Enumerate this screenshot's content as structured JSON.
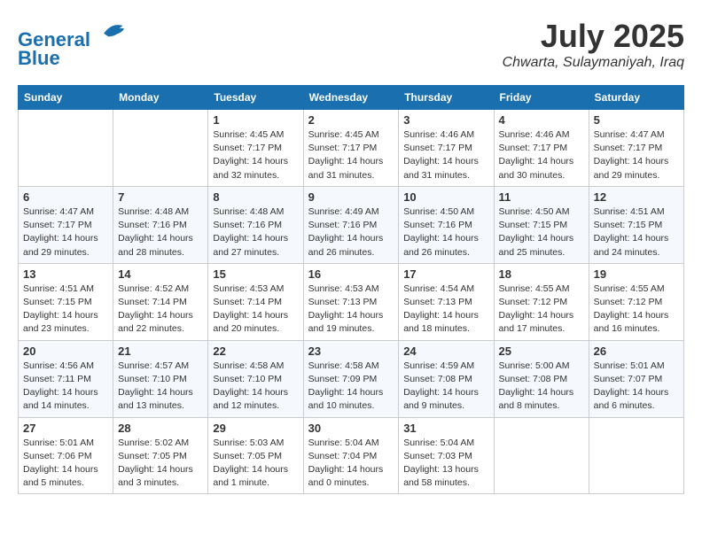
{
  "header": {
    "logo_line1": "General",
    "logo_line2": "Blue",
    "month_year": "July 2025",
    "location": "Chwarta, Sulaymaniyah, Iraq"
  },
  "weekdays": [
    "Sunday",
    "Monday",
    "Tuesday",
    "Wednesday",
    "Thursday",
    "Friday",
    "Saturday"
  ],
  "weeks": [
    [
      {
        "day": "",
        "info": ""
      },
      {
        "day": "",
        "info": ""
      },
      {
        "day": "1",
        "info": "Sunrise: 4:45 AM\nSunset: 7:17 PM\nDaylight: 14 hours\nand 32 minutes."
      },
      {
        "day": "2",
        "info": "Sunrise: 4:45 AM\nSunset: 7:17 PM\nDaylight: 14 hours\nand 31 minutes."
      },
      {
        "day": "3",
        "info": "Sunrise: 4:46 AM\nSunset: 7:17 PM\nDaylight: 14 hours\nand 31 minutes."
      },
      {
        "day": "4",
        "info": "Sunrise: 4:46 AM\nSunset: 7:17 PM\nDaylight: 14 hours\nand 30 minutes."
      },
      {
        "day": "5",
        "info": "Sunrise: 4:47 AM\nSunset: 7:17 PM\nDaylight: 14 hours\nand 29 minutes."
      }
    ],
    [
      {
        "day": "6",
        "info": "Sunrise: 4:47 AM\nSunset: 7:17 PM\nDaylight: 14 hours\nand 29 minutes."
      },
      {
        "day": "7",
        "info": "Sunrise: 4:48 AM\nSunset: 7:16 PM\nDaylight: 14 hours\nand 28 minutes."
      },
      {
        "day": "8",
        "info": "Sunrise: 4:48 AM\nSunset: 7:16 PM\nDaylight: 14 hours\nand 27 minutes."
      },
      {
        "day": "9",
        "info": "Sunrise: 4:49 AM\nSunset: 7:16 PM\nDaylight: 14 hours\nand 26 minutes."
      },
      {
        "day": "10",
        "info": "Sunrise: 4:50 AM\nSunset: 7:16 PM\nDaylight: 14 hours\nand 26 minutes."
      },
      {
        "day": "11",
        "info": "Sunrise: 4:50 AM\nSunset: 7:15 PM\nDaylight: 14 hours\nand 25 minutes."
      },
      {
        "day": "12",
        "info": "Sunrise: 4:51 AM\nSunset: 7:15 PM\nDaylight: 14 hours\nand 24 minutes."
      }
    ],
    [
      {
        "day": "13",
        "info": "Sunrise: 4:51 AM\nSunset: 7:15 PM\nDaylight: 14 hours\nand 23 minutes."
      },
      {
        "day": "14",
        "info": "Sunrise: 4:52 AM\nSunset: 7:14 PM\nDaylight: 14 hours\nand 22 minutes."
      },
      {
        "day": "15",
        "info": "Sunrise: 4:53 AM\nSunset: 7:14 PM\nDaylight: 14 hours\nand 20 minutes."
      },
      {
        "day": "16",
        "info": "Sunrise: 4:53 AM\nSunset: 7:13 PM\nDaylight: 14 hours\nand 19 minutes."
      },
      {
        "day": "17",
        "info": "Sunrise: 4:54 AM\nSunset: 7:13 PM\nDaylight: 14 hours\nand 18 minutes."
      },
      {
        "day": "18",
        "info": "Sunrise: 4:55 AM\nSunset: 7:12 PM\nDaylight: 14 hours\nand 17 minutes."
      },
      {
        "day": "19",
        "info": "Sunrise: 4:55 AM\nSunset: 7:12 PM\nDaylight: 14 hours\nand 16 minutes."
      }
    ],
    [
      {
        "day": "20",
        "info": "Sunrise: 4:56 AM\nSunset: 7:11 PM\nDaylight: 14 hours\nand 14 minutes."
      },
      {
        "day": "21",
        "info": "Sunrise: 4:57 AM\nSunset: 7:10 PM\nDaylight: 14 hours\nand 13 minutes."
      },
      {
        "day": "22",
        "info": "Sunrise: 4:58 AM\nSunset: 7:10 PM\nDaylight: 14 hours\nand 12 minutes."
      },
      {
        "day": "23",
        "info": "Sunrise: 4:58 AM\nSunset: 7:09 PM\nDaylight: 14 hours\nand 10 minutes."
      },
      {
        "day": "24",
        "info": "Sunrise: 4:59 AM\nSunset: 7:08 PM\nDaylight: 14 hours\nand 9 minutes."
      },
      {
        "day": "25",
        "info": "Sunrise: 5:00 AM\nSunset: 7:08 PM\nDaylight: 14 hours\nand 8 minutes."
      },
      {
        "day": "26",
        "info": "Sunrise: 5:01 AM\nSunset: 7:07 PM\nDaylight: 14 hours\nand 6 minutes."
      }
    ],
    [
      {
        "day": "27",
        "info": "Sunrise: 5:01 AM\nSunset: 7:06 PM\nDaylight: 14 hours\nand 5 minutes."
      },
      {
        "day": "28",
        "info": "Sunrise: 5:02 AM\nSunset: 7:05 PM\nDaylight: 14 hours\nand 3 minutes."
      },
      {
        "day": "29",
        "info": "Sunrise: 5:03 AM\nSunset: 7:05 PM\nDaylight: 14 hours\nand 1 minute."
      },
      {
        "day": "30",
        "info": "Sunrise: 5:04 AM\nSunset: 7:04 PM\nDaylight: 14 hours\nand 0 minutes."
      },
      {
        "day": "31",
        "info": "Sunrise: 5:04 AM\nSunset: 7:03 PM\nDaylight: 13 hours\nand 58 minutes."
      },
      {
        "day": "",
        "info": ""
      },
      {
        "day": "",
        "info": ""
      }
    ]
  ]
}
